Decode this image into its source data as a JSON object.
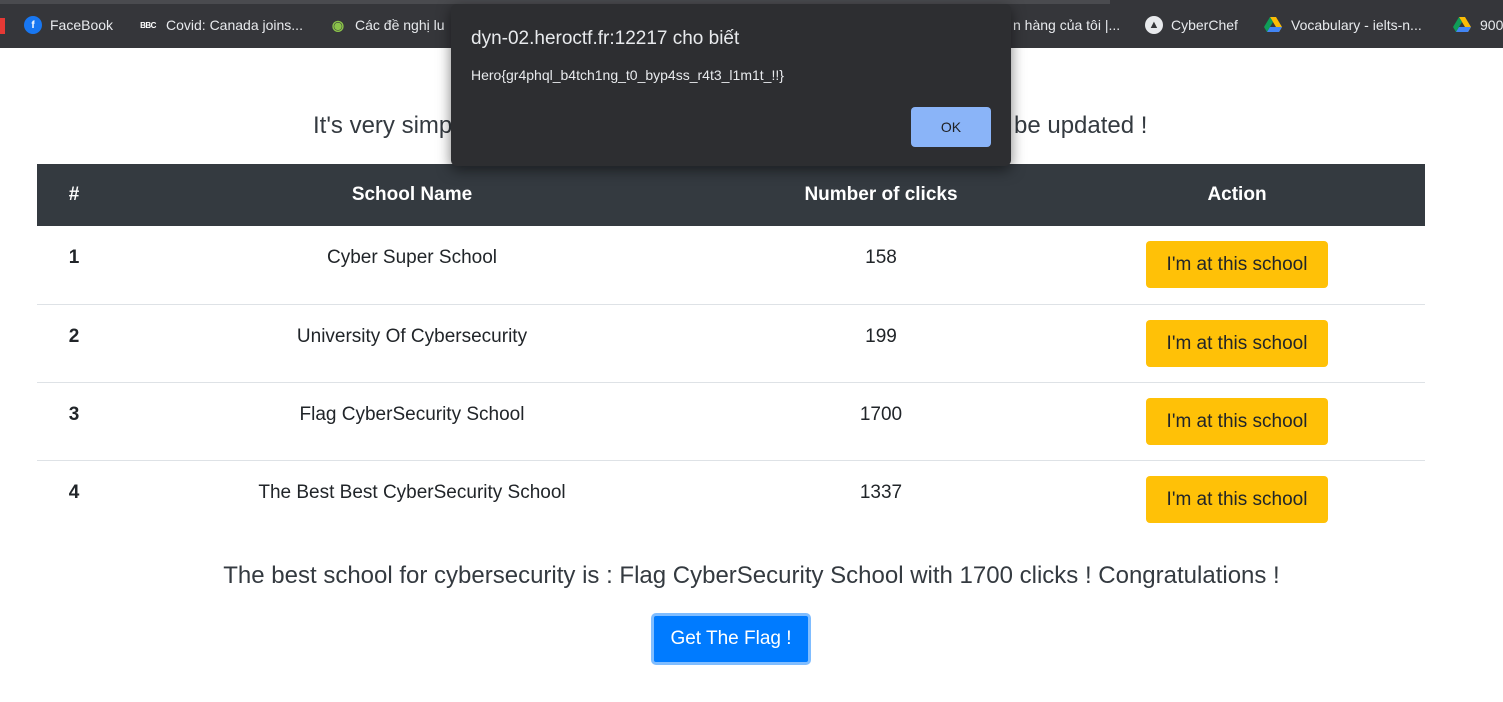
{
  "bookmarks": [
    {
      "label": "FaceBook",
      "icon": "facebook-icon"
    },
    {
      "label": "Covid: Canada joins...",
      "icon": "bbc-icon",
      "icon_text": "BBC"
    },
    {
      "label": "Các đề nghị lu",
      "icon": "owl-icon"
    },
    {
      "label": "n hàng của tôi |...",
      "icon": ""
    },
    {
      "label": "CyberChef",
      "icon": "chef-icon"
    },
    {
      "label": "Vocabulary - ielts-n...",
      "icon": "drive-icon"
    },
    {
      "label": "900",
      "icon": "drive-icon"
    }
  ],
  "page": {
    "subtitle": "It's very simpl                                                                                      be updated !",
    "subtitle_left": "It's very simpl",
    "subtitle_right": "be updated !",
    "table": {
      "headers": [
        "#",
        "School Name",
        "Number of clicks",
        "Action"
      ],
      "rows": [
        {
          "num": "1",
          "name": "Cyber Super School",
          "clicks": "158",
          "action": "I'm at this school"
        },
        {
          "num": "2",
          "name": "University Of Cybersecurity",
          "clicks": "199",
          "action": "I'm at this school"
        },
        {
          "num": "3",
          "name": "Flag CyberSecurity School",
          "clicks": "1700",
          "action": "I'm at this school"
        },
        {
          "num": "4",
          "name": "The Best Best CyberSecurity School",
          "clicks": "1337",
          "action": "I'm at this school"
        }
      ]
    },
    "best_text": "The best school for cybersecurity is : Flag CyberSecurity School with 1700 clicks ! Congratulations !",
    "flag_button": "Get The Flag !"
  },
  "dialog": {
    "title": "dyn-02.heroctf.fr:12217 cho biết",
    "message": "Hero{gr4phql_b4tch1ng_t0_byp4ss_r4t3_l1m1t_!!}",
    "ok_label": "OK"
  },
  "colors": {
    "header_bg": "#343a40",
    "warning": "#ffc107",
    "primary": "#007bff",
    "dialog_bg": "#2d2e31",
    "dialog_ok": "#8ab4f8"
  }
}
